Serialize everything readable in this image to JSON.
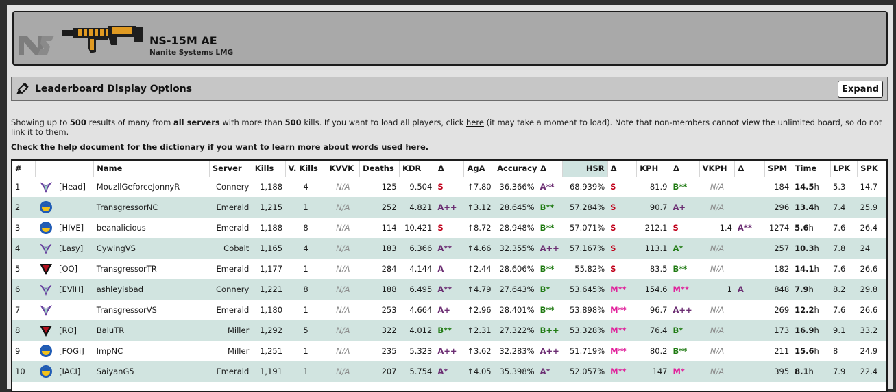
{
  "weapon": {
    "name": "NS-15M AE",
    "maker": "Nanite Systems",
    "category": "LMG",
    "logo_icon": "nanite-systems-logo-icon",
    "image_icon": "lmg-weapon-icon"
  },
  "options": {
    "title": "Leaderboard Display Options",
    "icon": "paintbrush-icon",
    "expand_label": "Expand"
  },
  "info": {
    "p1": "Showing up to ",
    "max_results": "500",
    "p2": " results of many from ",
    "servers": "all servers",
    "p3": " with more than ",
    "min_kills": "500",
    "p4": " kills. If you want to load all players, click ",
    "link": "here",
    "p5": " (it may take a moment to load). Note that non-members cannot view the unlimited board, so do not link it to them."
  },
  "help": {
    "prefix": "Check ",
    "link": "the help document for the dictionary",
    "suffix": " if you want to learn more about words used here."
  },
  "colors": {
    "vs": "#6a3fa0",
    "nc": "#1f5bb5",
    "tr": "#b3121f",
    "grade_s": "#c0001a",
    "grade_a": "#6b2d72",
    "grade_b": "#1f7a12",
    "grade_m": "#e0209a"
  },
  "columns": [
    "#",
    "",
    "",
    "Name",
    "Server",
    "Kills",
    "V. Kills",
    "KVVK",
    "Deaths",
    "KDR",
    "Δ",
    "AgA",
    "Accuracy",
    "Δ",
    "HSR",
    "Δ",
    "KPH",
    "Δ",
    "VKPH",
    "Δ",
    "SPM",
    "Time",
    "LPK",
    "SPK"
  ],
  "rows": [
    {
      "rank": "1",
      "faction": "vs",
      "outfit": "[Head]",
      "name": "MouzllGeforceJonnyR",
      "server": "Connery",
      "kills": "1,188",
      "vkills": "4",
      "kvvk": "N/A",
      "deaths": "125",
      "kdr": "9.504",
      "kdr_g": "S",
      "kdr_c": "S",
      "aga": "↑7.80",
      "acc": "36.366%",
      "acc_g": "A**",
      "acc_c": "A",
      "hsr": "68.939%",
      "hsr_g": "S",
      "hsr_c": "S",
      "kph": "81.9",
      "kph_g": "B**",
      "kph_c": "B",
      "vkph": "N/A",
      "vkph_g": "",
      "vkph_c": "",
      "spm": "184",
      "time": "14.5",
      "lpk": "5.3",
      "spk": "14.7"
    },
    {
      "rank": "2",
      "faction": "nc",
      "outfit": "",
      "name": "TransgressorNC",
      "server": "Emerald",
      "kills": "1,215",
      "vkills": "1",
      "kvvk": "N/A",
      "deaths": "252",
      "kdr": "4.821",
      "kdr_g": "A++",
      "kdr_c": "A",
      "aga": "↑3.12",
      "acc": "28.645%",
      "acc_g": "B**",
      "acc_c": "B",
      "hsr": "57.284%",
      "hsr_g": "S",
      "hsr_c": "S",
      "kph": "90.7",
      "kph_g": "A+",
      "kph_c": "A",
      "vkph": "N/A",
      "vkph_g": "",
      "vkph_c": "",
      "spm": "296",
      "time": "13.4",
      "lpk": "7.4",
      "spk": "25.9"
    },
    {
      "rank": "3",
      "faction": "nc",
      "outfit": "[HIVE]",
      "name": "beanalicious",
      "server": "Emerald",
      "kills": "1,188",
      "vkills": "8",
      "kvvk": "N/A",
      "deaths": "114",
      "kdr": "10.421",
      "kdr_g": "S",
      "kdr_c": "S",
      "aga": "↑8.72",
      "acc": "28.948%",
      "acc_g": "B**",
      "acc_c": "B",
      "hsr": "57.071%",
      "hsr_g": "S",
      "hsr_c": "S",
      "kph": "212.1",
      "kph_g": "S",
      "kph_c": "S",
      "vkph": "1.4",
      "vkph_g": "A**",
      "vkph_c": "A",
      "spm": "1274",
      "time": "5.6",
      "lpk": "7.6",
      "spk": "26.4"
    },
    {
      "rank": "4",
      "faction": "vs",
      "outfit": "[Lasy]",
      "name": "CywingVS",
      "server": "Cobalt",
      "kills": "1,165",
      "vkills": "4",
      "kvvk": "N/A",
      "deaths": "183",
      "kdr": "6.366",
      "kdr_g": "A**",
      "kdr_c": "A",
      "aga": "↑4.66",
      "acc": "32.355%",
      "acc_g": "A++",
      "acc_c": "A",
      "hsr": "57.167%",
      "hsr_g": "S",
      "hsr_c": "S",
      "kph": "113.1",
      "kph_g": "A*",
      "kph_c": "B",
      "vkph": "N/A",
      "vkph_g": "",
      "vkph_c": "",
      "spm": "257",
      "time": "10.3",
      "lpk": "7.8",
      "spk": "24"
    },
    {
      "rank": "5",
      "faction": "tr",
      "outfit": "[OO]",
      "name": "TransgressorTR",
      "server": "Emerald",
      "kills": "1,177",
      "vkills": "1",
      "kvvk": "N/A",
      "deaths": "284",
      "kdr": "4.144",
      "kdr_g": "A",
      "kdr_c": "A",
      "aga": "↑2.44",
      "acc": "28.606%",
      "acc_g": "B**",
      "acc_c": "B",
      "hsr": "55.82%",
      "hsr_g": "S",
      "hsr_c": "S",
      "kph": "83.5",
      "kph_g": "B**",
      "kph_c": "B",
      "vkph": "N/A",
      "vkph_g": "",
      "vkph_c": "",
      "spm": "182",
      "time": "14.1",
      "lpk": "7.6",
      "spk": "26.6"
    },
    {
      "rank": "6",
      "faction": "vs",
      "outfit": "[EVlH]",
      "name": "ashleyisbad",
      "server": "Connery",
      "kills": "1,221",
      "vkills": "8",
      "kvvk": "N/A",
      "deaths": "188",
      "kdr": "6.495",
      "kdr_g": "A**",
      "kdr_c": "A",
      "aga": "↑4.79",
      "acc": "27.643%",
      "acc_g": "B*",
      "acc_c": "B",
      "hsr": "53.645%",
      "hsr_g": "M**",
      "hsr_c": "M",
      "kph": "154.6",
      "kph_g": "M**",
      "kph_c": "M",
      "vkph": "1",
      "vkph_g": "A",
      "vkph_c": "A",
      "spm": "848",
      "time": "7.9",
      "lpk": "8.2",
      "spk": "29.8"
    },
    {
      "rank": "7",
      "faction": "vs",
      "outfit": "",
      "name": "TransgressorVS",
      "server": "Emerald",
      "kills": "1,180",
      "vkills": "1",
      "kvvk": "N/A",
      "deaths": "253",
      "kdr": "4.664",
      "kdr_g": "A+",
      "kdr_c": "A",
      "aga": "↑2.96",
      "acc": "28.401%",
      "acc_g": "B**",
      "acc_c": "B",
      "hsr": "53.898%",
      "hsr_g": "M**",
      "hsr_c": "M",
      "kph": "96.7",
      "kph_g": "A++",
      "kph_c": "A",
      "vkph": "N/A",
      "vkph_g": "",
      "vkph_c": "",
      "spm": "269",
      "time": "12.2",
      "lpk": "7.6",
      "spk": "26.6"
    },
    {
      "rank": "8",
      "faction": "tr",
      "outfit": "[RO]",
      "name": "BaluTR",
      "server": "Miller",
      "kills": "1,292",
      "vkills": "5",
      "kvvk": "N/A",
      "deaths": "322",
      "kdr": "4.012",
      "kdr_g": "B**",
      "kdr_c": "B",
      "aga": "↑2.31",
      "acc": "27.322%",
      "acc_g": "B++",
      "acc_c": "B",
      "hsr": "53.328%",
      "hsr_g": "M**",
      "hsr_c": "M",
      "kph": "76.4",
      "kph_g": "B*",
      "kph_c": "B",
      "vkph": "N/A",
      "vkph_g": "",
      "vkph_c": "",
      "spm": "173",
      "time": "16.9",
      "lpk": "9.1",
      "spk": "33.2"
    },
    {
      "rank": "9",
      "faction": "nc",
      "outfit": "[FOGi]",
      "name": "lmpNC",
      "server": "Miller",
      "kills": "1,251",
      "vkills": "1",
      "kvvk": "N/A",
      "deaths": "235",
      "kdr": "5.323",
      "kdr_g": "A++",
      "kdr_c": "A",
      "aga": "↑3.62",
      "acc": "32.283%",
      "acc_g": "A++",
      "acc_c": "A",
      "hsr": "51.719%",
      "hsr_g": "M**",
      "hsr_c": "M",
      "kph": "80.2",
      "kph_g": "B**",
      "kph_c": "B",
      "vkph": "N/A",
      "vkph_g": "",
      "vkph_c": "",
      "spm": "211",
      "time": "15.6",
      "lpk": "8",
      "spk": "24.9"
    },
    {
      "rank": "10",
      "faction": "nc",
      "outfit": "[IACI]",
      "name": "SaiyanG5",
      "server": "Emerald",
      "kills": "1,191",
      "vkills": "1",
      "kvvk": "N/A",
      "deaths": "207",
      "kdr": "5.754",
      "kdr_g": "A*",
      "kdr_c": "A",
      "aga": "↑4.05",
      "acc": "35.398%",
      "acc_g": "A*",
      "acc_c": "A",
      "hsr": "52.057%",
      "hsr_g": "M**",
      "hsr_c": "M",
      "kph": "147",
      "kph_g": "M*",
      "kph_c": "M",
      "vkph": "N/A",
      "vkph_g": "",
      "vkph_c": "",
      "spm": "395",
      "time": "8.1",
      "lpk": "7.9",
      "spk": "22.4"
    }
  ],
  "time_unit": "h"
}
